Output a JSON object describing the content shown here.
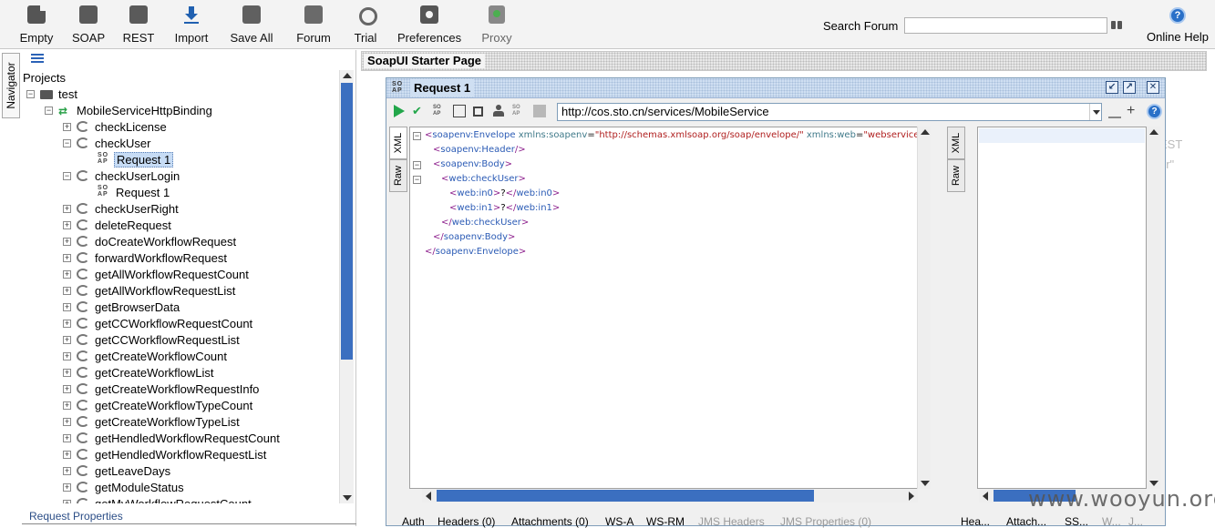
{
  "toolbar": {
    "buttons": [
      {
        "label": "Empty",
        "icon": "empty-project-icon"
      },
      {
        "label": "SOAP",
        "icon": "soap-project-icon"
      },
      {
        "label": "REST",
        "icon": "rest-project-icon"
      },
      {
        "label": "Import",
        "icon": "import-icon"
      },
      {
        "label": "Save All",
        "icon": "save-all-icon"
      },
      {
        "label": "Forum",
        "icon": "forum-icon"
      },
      {
        "label": "Trial",
        "icon": "trial-icon"
      },
      {
        "label": "Preferences",
        "icon": "preferences-gear-icon"
      },
      {
        "label": "Proxy",
        "icon": "proxy-icon"
      }
    ],
    "soap_glyph": "SO\nAP",
    "rest_glyph": "RE\nST",
    "search_label": "Search Forum",
    "search_value": "",
    "help_label": "Online Help",
    "help_glyph": "?"
  },
  "navigator": {
    "tab_label": "Navigator",
    "projects_label": "Projects",
    "request_properties_label": "Request Properties",
    "tree": [
      {
        "label": "test",
        "kind": "project",
        "level": 0,
        "expander": "-"
      },
      {
        "label": "MobileServiceHttpBinding",
        "kind": "interface",
        "level": 1,
        "expander": "-"
      },
      {
        "label": "checkLicense",
        "kind": "operation",
        "level": 2,
        "expander": "+"
      },
      {
        "label": "checkUser",
        "kind": "operation",
        "level": 2,
        "expander": "-"
      },
      {
        "label": "Request 1",
        "kind": "request",
        "level": 3,
        "expander": "",
        "selected": true
      },
      {
        "label": "checkUserLogin",
        "kind": "operation",
        "level": 2,
        "expander": "-"
      },
      {
        "label": "Request 1",
        "kind": "request",
        "level": 3,
        "expander": ""
      },
      {
        "label": "checkUserRight",
        "kind": "operation",
        "level": 2,
        "expander": "+"
      },
      {
        "label": "deleteRequest",
        "kind": "operation",
        "level": 2,
        "expander": "+"
      },
      {
        "label": "doCreateWorkflowRequest",
        "kind": "operation",
        "level": 2,
        "expander": "+"
      },
      {
        "label": "forwardWorkflowRequest",
        "kind": "operation",
        "level": 2,
        "expander": "+"
      },
      {
        "label": "getAllWorkflowRequestCount",
        "kind": "operation",
        "level": 2,
        "expander": "+"
      },
      {
        "label": "getAllWorkflowRequestList",
        "kind": "operation",
        "level": 2,
        "expander": "+"
      },
      {
        "label": "getBrowserData",
        "kind": "operation",
        "level": 2,
        "expander": "+"
      },
      {
        "label": "getCCWorkflowRequestCount",
        "kind": "operation",
        "level": 2,
        "expander": "+"
      },
      {
        "label": "getCCWorkflowRequestList",
        "kind": "operation",
        "level": 2,
        "expander": "+"
      },
      {
        "label": "getCreateWorkflowCount",
        "kind": "operation",
        "level": 2,
        "expander": "+"
      },
      {
        "label": "getCreateWorkflowList",
        "kind": "operation",
        "level": 2,
        "expander": "+"
      },
      {
        "label": "getCreateWorkflowRequestInfo",
        "kind": "operation",
        "level": 2,
        "expander": "+"
      },
      {
        "label": "getCreateWorkflowTypeCount",
        "kind": "operation",
        "level": 2,
        "expander": "+"
      },
      {
        "label": "getCreateWorkflowTypeList",
        "kind": "operation",
        "level": 2,
        "expander": "+"
      },
      {
        "label": "getHendledWorkflowRequestCount",
        "kind": "operation",
        "level": 2,
        "expander": "+"
      },
      {
        "label": "getHendledWorkflowRequestList",
        "kind": "operation",
        "level": 2,
        "expander": "+"
      },
      {
        "label": "getLeaveDays",
        "kind": "operation",
        "level": 2,
        "expander": "+"
      },
      {
        "label": "getModuleStatus",
        "kind": "operation",
        "level": 2,
        "expander": "+"
      },
      {
        "label": "getMyWorkflowRequestCount",
        "kind": "operation",
        "level": 2,
        "expander": "+"
      }
    ]
  },
  "starter_page": {
    "title": "SoapUI Starter Page",
    "bg_text_1": "EST",
    "bg_text_2": "er\""
  },
  "request_window": {
    "title": "Request 1",
    "soap_glyph": "SO\nAP",
    "endpoint": "http://cos.sto.cn/services/MobileService",
    "help_glyph": "?",
    "side_tabs": [
      "XML",
      "Raw"
    ],
    "response_side_tabs": [
      "XML",
      "Raw"
    ],
    "xml_lines": [
      {
        "indent": 0,
        "fold": "-",
        "parts": [
          [
            "tag",
            "<"
          ],
          [
            "ename",
            "soapenv:Envelope"
          ],
          [
            "text",
            " "
          ],
          [
            "attr",
            "xmlns:soapenv"
          ],
          [
            "text",
            "="
          ],
          [
            "val",
            "\"http://schemas.xmlsoap.org/soap/envelope/\""
          ],
          [
            "text",
            " "
          ],
          [
            "attr",
            "xmlns:web"
          ],
          [
            "text",
            "="
          ],
          [
            "val",
            "\"webservices.se"
          ]
        ]
      },
      {
        "indent": 1,
        "fold": "",
        "parts": [
          [
            "tag",
            "<"
          ],
          [
            "ename",
            "soapenv:Header"
          ],
          [
            "tag",
            "/>"
          ]
        ]
      },
      {
        "indent": 1,
        "fold": "-",
        "parts": [
          [
            "tag",
            "<"
          ],
          [
            "ename",
            "soapenv:Body"
          ],
          [
            "tag",
            ">"
          ]
        ]
      },
      {
        "indent": 2,
        "fold": "-",
        "parts": [
          [
            "tag",
            "<"
          ],
          [
            "ename",
            "web:checkUser"
          ],
          [
            "tag",
            ">"
          ]
        ]
      },
      {
        "indent": 3,
        "fold": "",
        "parts": [
          [
            "tag",
            "<"
          ],
          [
            "ename",
            "web:in0"
          ],
          [
            "tag",
            ">"
          ],
          [
            "text",
            "?"
          ],
          [
            "tag",
            "</"
          ],
          [
            "ename",
            "web:in0"
          ],
          [
            "tag",
            ">"
          ]
        ]
      },
      {
        "indent": 3,
        "fold": "",
        "parts": [
          [
            "tag",
            "<"
          ],
          [
            "ename",
            "web:in1"
          ],
          [
            "tag",
            ">"
          ],
          [
            "text",
            "?"
          ],
          [
            "tag",
            "</"
          ],
          [
            "ename",
            "web:in1"
          ],
          [
            "tag",
            ">"
          ]
        ]
      },
      {
        "indent": 2,
        "fold": "",
        "parts": [
          [
            "tag",
            "</"
          ],
          [
            "ename",
            "web:checkUser"
          ],
          [
            "tag",
            ">"
          ]
        ]
      },
      {
        "indent": 1,
        "fold": "",
        "parts": [
          [
            "tag",
            "</"
          ],
          [
            "ename",
            "soapenv:Body"
          ],
          [
            "tag",
            ">"
          ]
        ]
      },
      {
        "indent": 0,
        "fold": "",
        "parts": [
          [
            "tag",
            "</"
          ],
          [
            "ename",
            "soapenv:Envelope"
          ],
          [
            "tag",
            ">"
          ]
        ]
      }
    ],
    "bottom_tabs": [
      {
        "label": "Auth",
        "enabled": true
      },
      {
        "label": "Headers (0)",
        "enabled": true
      },
      {
        "label": "Attachments (0)",
        "enabled": true
      },
      {
        "label": "WS-A",
        "enabled": true
      },
      {
        "label": "WS-RM",
        "enabled": true
      },
      {
        "label": "JMS Headers",
        "enabled": false
      },
      {
        "label": "JMS Properties (0)",
        "enabled": false
      }
    ],
    "response_tabs": [
      {
        "label": "Hea...",
        "enabled": true
      },
      {
        "label": "Attach...",
        "enabled": true
      },
      {
        "label": "SS...",
        "enabled": true
      },
      {
        "label": "W...",
        "enabled": false
      },
      {
        "label": "J...",
        "enabled": false
      }
    ]
  },
  "watermark": "www.wooyun.org",
  "colors": {
    "accent": "#3b6fc0",
    "selection": "#c7dcf5",
    "run_green": "#22a64a",
    "titlebar": "#cfdff2"
  }
}
